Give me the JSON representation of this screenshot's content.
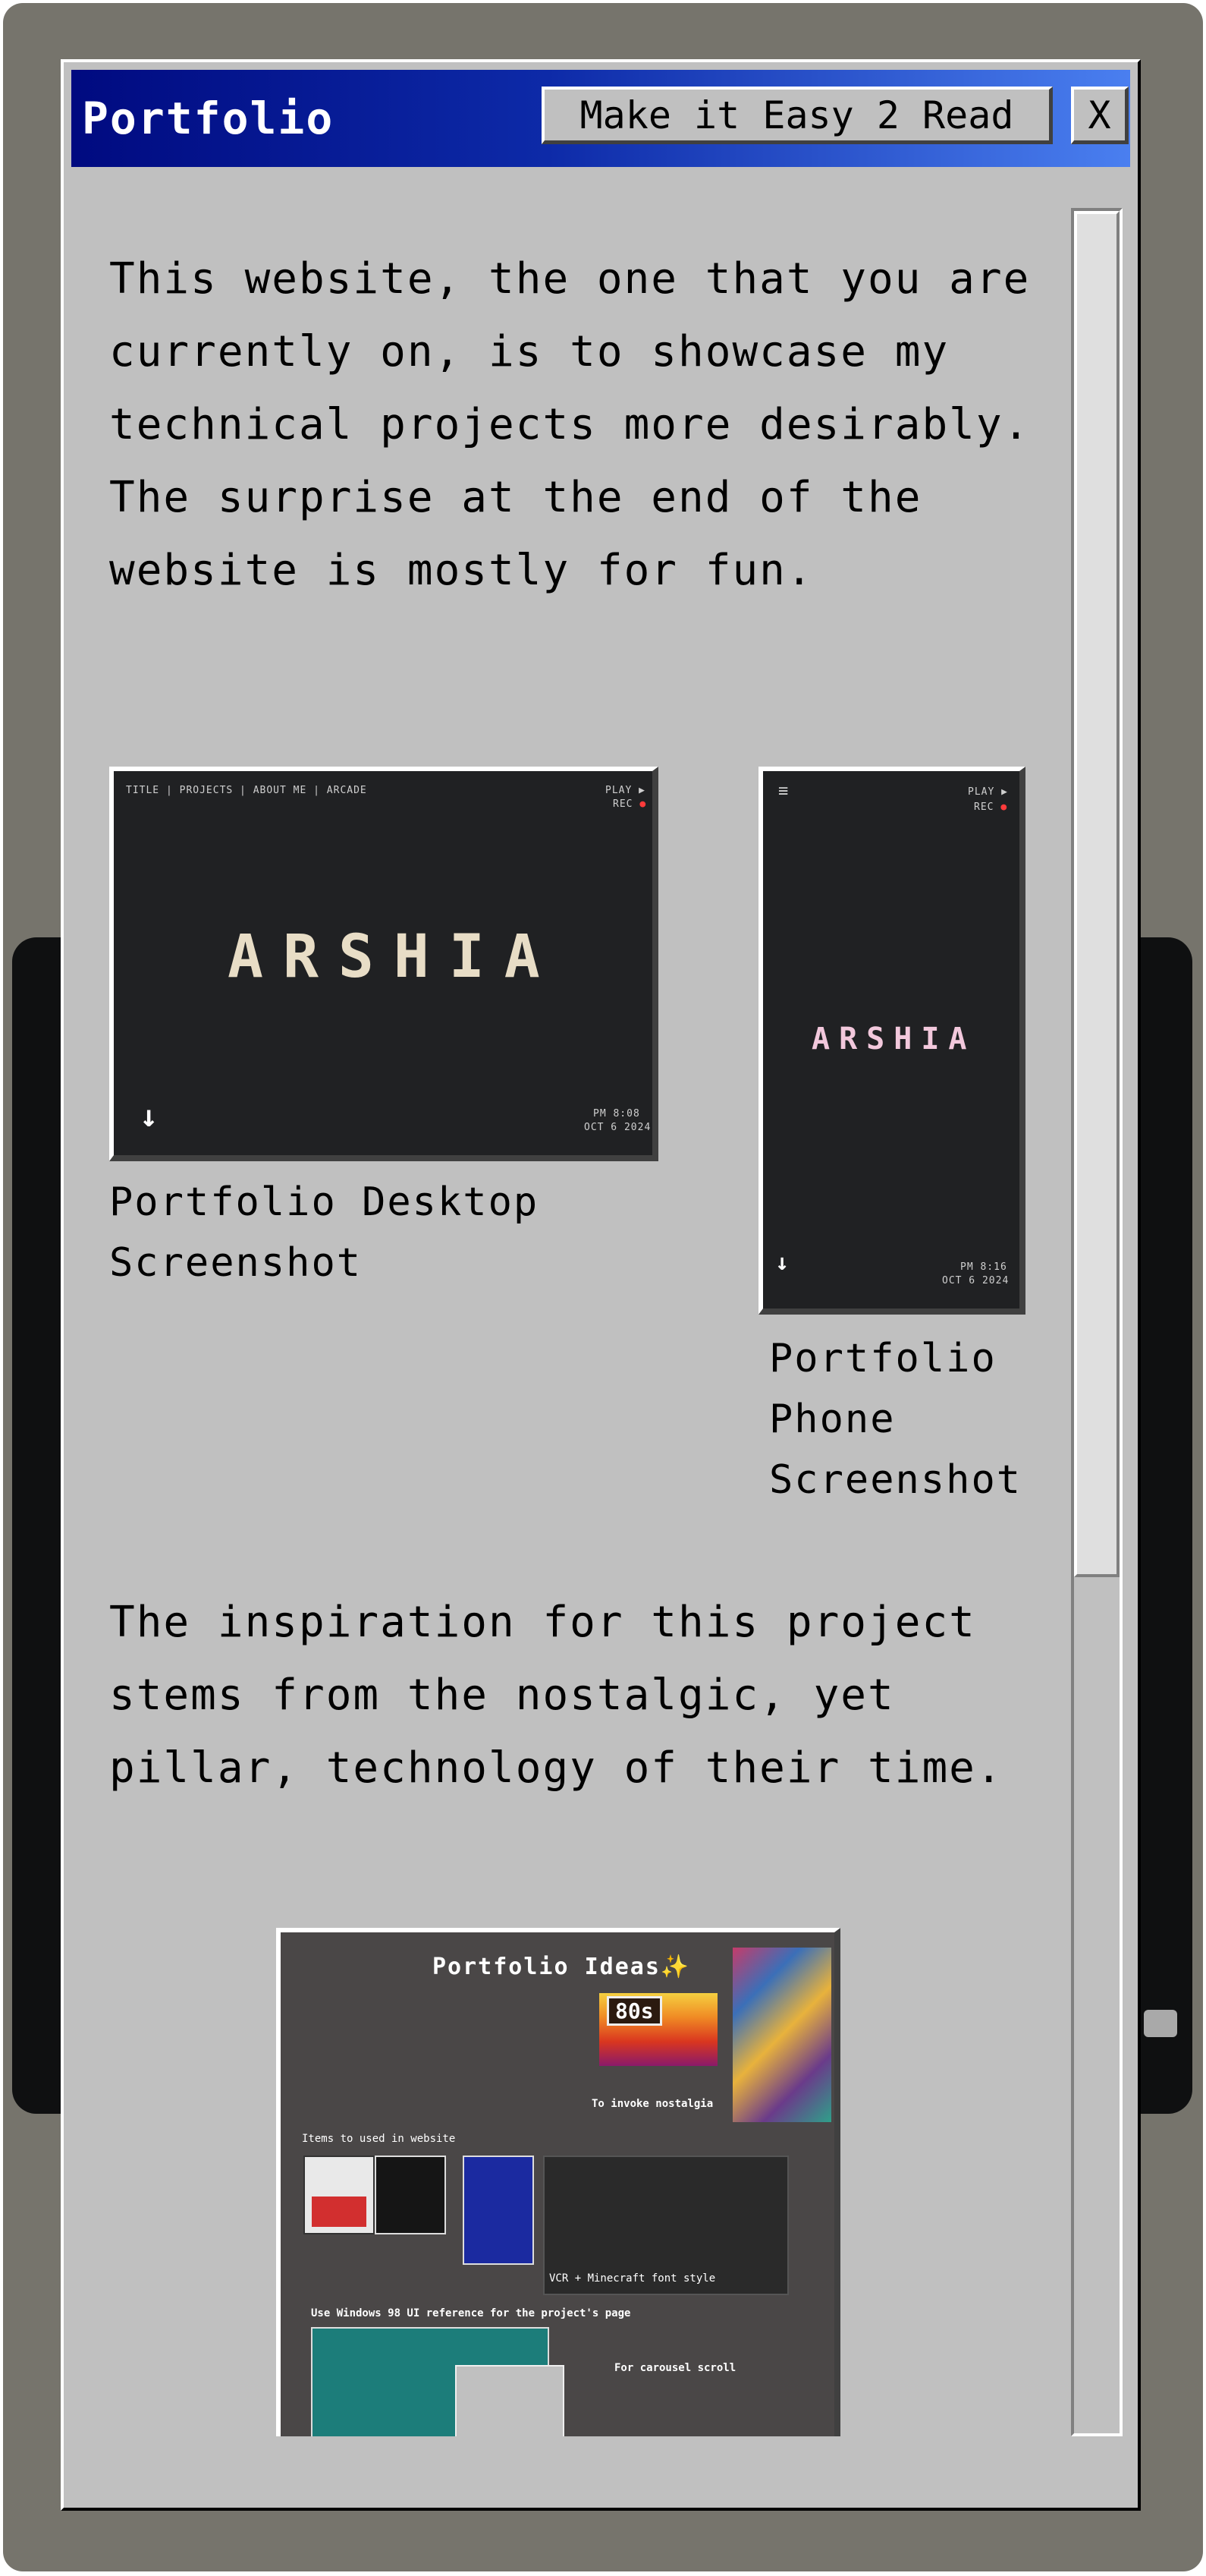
{
  "window": {
    "title": "Portfolio",
    "easy_read_button": "Make it Easy 2 Read",
    "close_button": "X"
  },
  "content": {
    "intro": "This website, the one that you are currently on, is to showcase my technical projects more desirably. The surprise at the end of the website is mostly for fun.",
    "desktop_caption": "Portfolio Desktop Screenshot",
    "phone_caption": "Portfolio Phone Screenshot",
    "inspiration": "The inspiration for this project stems from the nostalgic, yet pillar, technology of their time."
  },
  "desktop_shot": {
    "nav": "TITLE | PROJECTS | ABOUT ME | ARCADE",
    "play": "PLAY ▶",
    "rec": "REC",
    "name": "ARSHIA",
    "time": "PM 8:08",
    "date": "OCT 6 2024"
  },
  "phone_shot": {
    "menu": "≡",
    "play": "PLAY ▶",
    "rec": "REC",
    "name": "ARSHIA",
    "time": "PM 8:16",
    "date": "OCT 6 2024"
  },
  "ideas_board": {
    "title": "Portfolio Ideas✨",
    "tag_80s": "80s",
    "nostalgia": "To invoke nostalgia",
    "items_label": "Items to used in website",
    "vcr_note": "VCR + Minecraft font style",
    "win98_note": "Use Windows 98 UI reference for the project's page",
    "carousel_note": "For carousel scroll"
  },
  "colors": {
    "title_gradient_start": "#000a80",
    "title_gradient_end": "#4a7ff0",
    "window_bg": "#c0c0c0",
    "frame": "#76746c",
    "tv_body": "#0f1011"
  }
}
